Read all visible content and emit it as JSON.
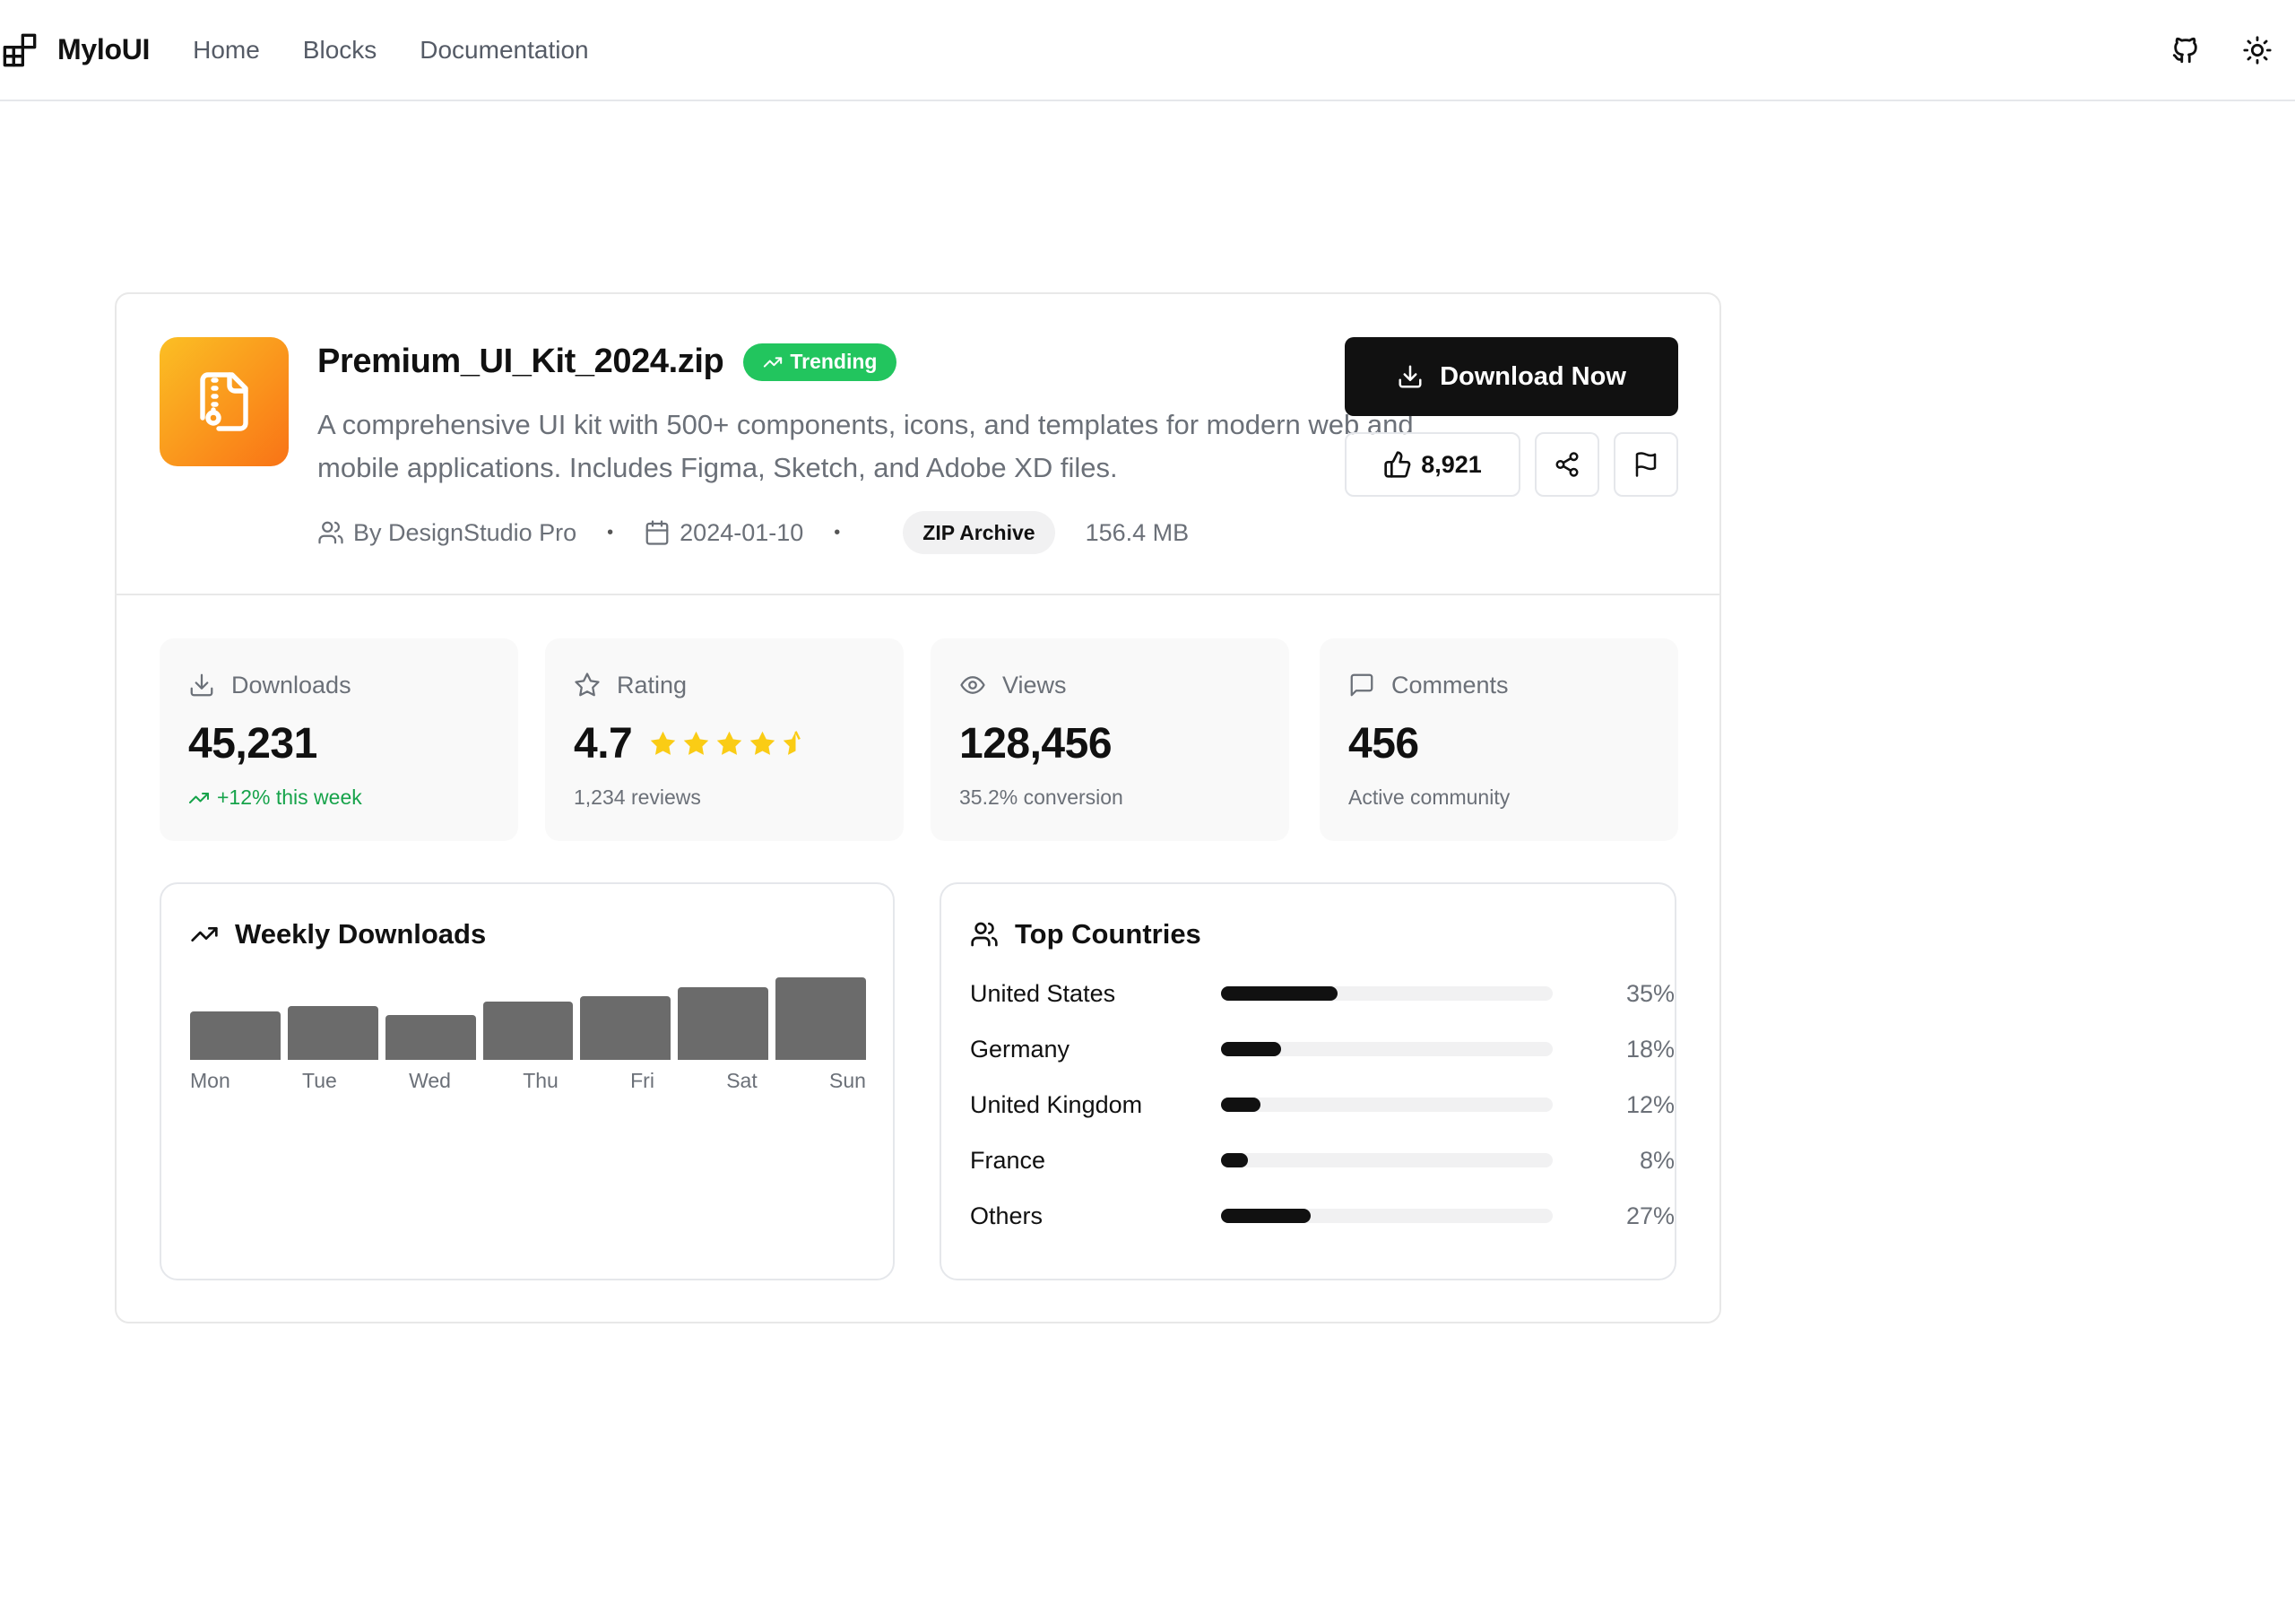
{
  "nav": {
    "brand": "MyloUI",
    "links": [
      "Home",
      "Blocks",
      "Documentation"
    ]
  },
  "file": {
    "title": "Premium_UI_Kit_2024.zip",
    "badge": "Trending",
    "description": "A comprehensive UI kit with 500+ components, icons, and templates for modern web and mobile applications. Includes Figma, Sketch, and Adobe XD files.",
    "author": "By DesignStudio Pro",
    "date": "2024-01-10",
    "type": "ZIP Archive",
    "size": "156.4 MB"
  },
  "actions": {
    "download": "Download Now",
    "likes": "8,921"
  },
  "stats": [
    {
      "label": "Downloads",
      "icon": "download-icon",
      "value": "45,231",
      "sub": "+12% this week"
    },
    {
      "label": "Rating",
      "icon": "star-icon",
      "value": "4.7",
      "rating": 4.7,
      "sub": "1,234 reviews"
    },
    {
      "label": "Views",
      "icon": "eye-icon",
      "value": "128,456",
      "sub": "35.2% conversion"
    },
    {
      "label": "Comments",
      "icon": "message-icon",
      "value": "456",
      "sub": "Active community"
    }
  ],
  "weekly": {
    "title": "Weekly Downloads",
    "days": [
      "Mon",
      "Tue",
      "Wed",
      "Thu",
      "Fri",
      "Sat",
      "Sun"
    ],
    "values": [
      0.56,
      0.62,
      0.52,
      0.68,
      0.74,
      0.84,
      0.96
    ]
  },
  "countries": {
    "title": "Top Countries",
    "items": [
      {
        "name": "United States",
        "pct": "35%",
        "value": 35
      },
      {
        "name": "Germany",
        "pct": "18%",
        "value": 18
      },
      {
        "name": "United Kingdom",
        "pct": "12%",
        "value": 12
      },
      {
        "name": "France",
        "pct": "8%",
        "value": 8
      },
      {
        "name": "Others",
        "pct": "27%",
        "value": 27
      }
    ]
  },
  "colors": {
    "accent": "#111111",
    "trending": "#22c55e",
    "positive": "#16a34a",
    "star": "#facc15",
    "iconGradient": [
      "#fbbf24",
      "#f97316"
    ]
  }
}
